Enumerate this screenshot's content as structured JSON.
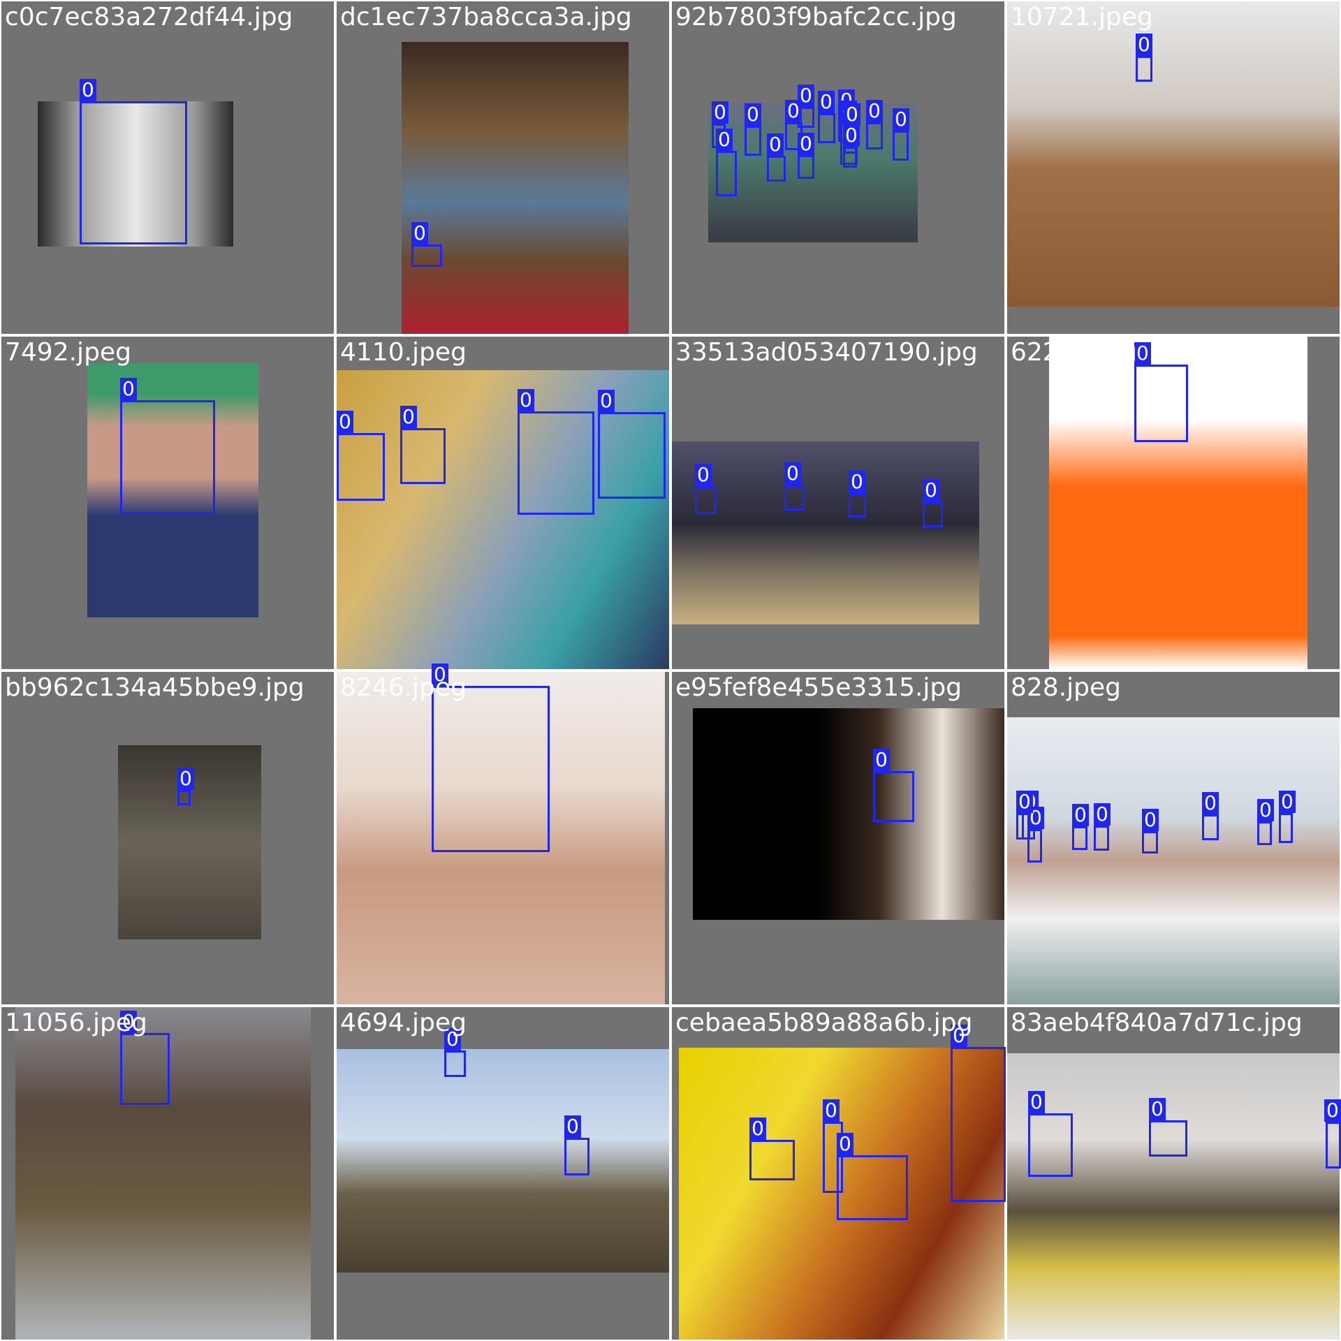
{
  "tiles": [
    {
      "filename": "c0c7ec83a272df44.jpg",
      "class_label": "0",
      "face_count": 1
    },
    {
      "filename": "dc1ec737ba8cca3a.jpg",
      "class_label": "0",
      "face_count": 1
    },
    {
      "filename": "92b7803f9bafc2cc.jpg",
      "class_label": "0",
      "face_count": 14
    },
    {
      "filename": "10721.jpeg",
      "class_label": "0",
      "face_count": 1
    },
    {
      "filename": "7492.jpeg",
      "class_label": "0",
      "face_count": 1
    },
    {
      "filename": "4110.jpeg",
      "class_label": "0",
      "face_count": 4
    },
    {
      "filename": "33513ad053407190.jpg",
      "class_label": "0",
      "face_count": 4
    },
    {
      "filename": "6221.jpeg",
      "class_label": "0",
      "face_count": 1
    },
    {
      "filename": "bb962c134a45bbe9.jpg",
      "class_label": "0",
      "face_count": 1
    },
    {
      "filename": "8246.jpeg",
      "class_label": "0",
      "face_count": 1
    },
    {
      "filename": "e95fef8e455e3315.jpg",
      "class_label": "0",
      "face_count": 1
    },
    {
      "filename": "828.jpeg",
      "class_label": "0",
      "face_count": 9
    },
    {
      "filename": "11056.jpeg",
      "class_label": "0",
      "face_count": 1
    },
    {
      "filename": "4694.jpeg",
      "class_label": "0",
      "face_count": 2
    },
    {
      "filename": "cebaea5b89a88a6b.jpg",
      "class_label": "0",
      "face_count": 4
    },
    {
      "filename": "83aeb4f840a7d71c.jpg",
      "class_label": "0",
      "face_count": 3
    }
  ],
  "colors": {
    "box": "#1f26f0",
    "label_text": "#ffffff",
    "filename_text": "#ffffff",
    "padding": "#727272"
  }
}
